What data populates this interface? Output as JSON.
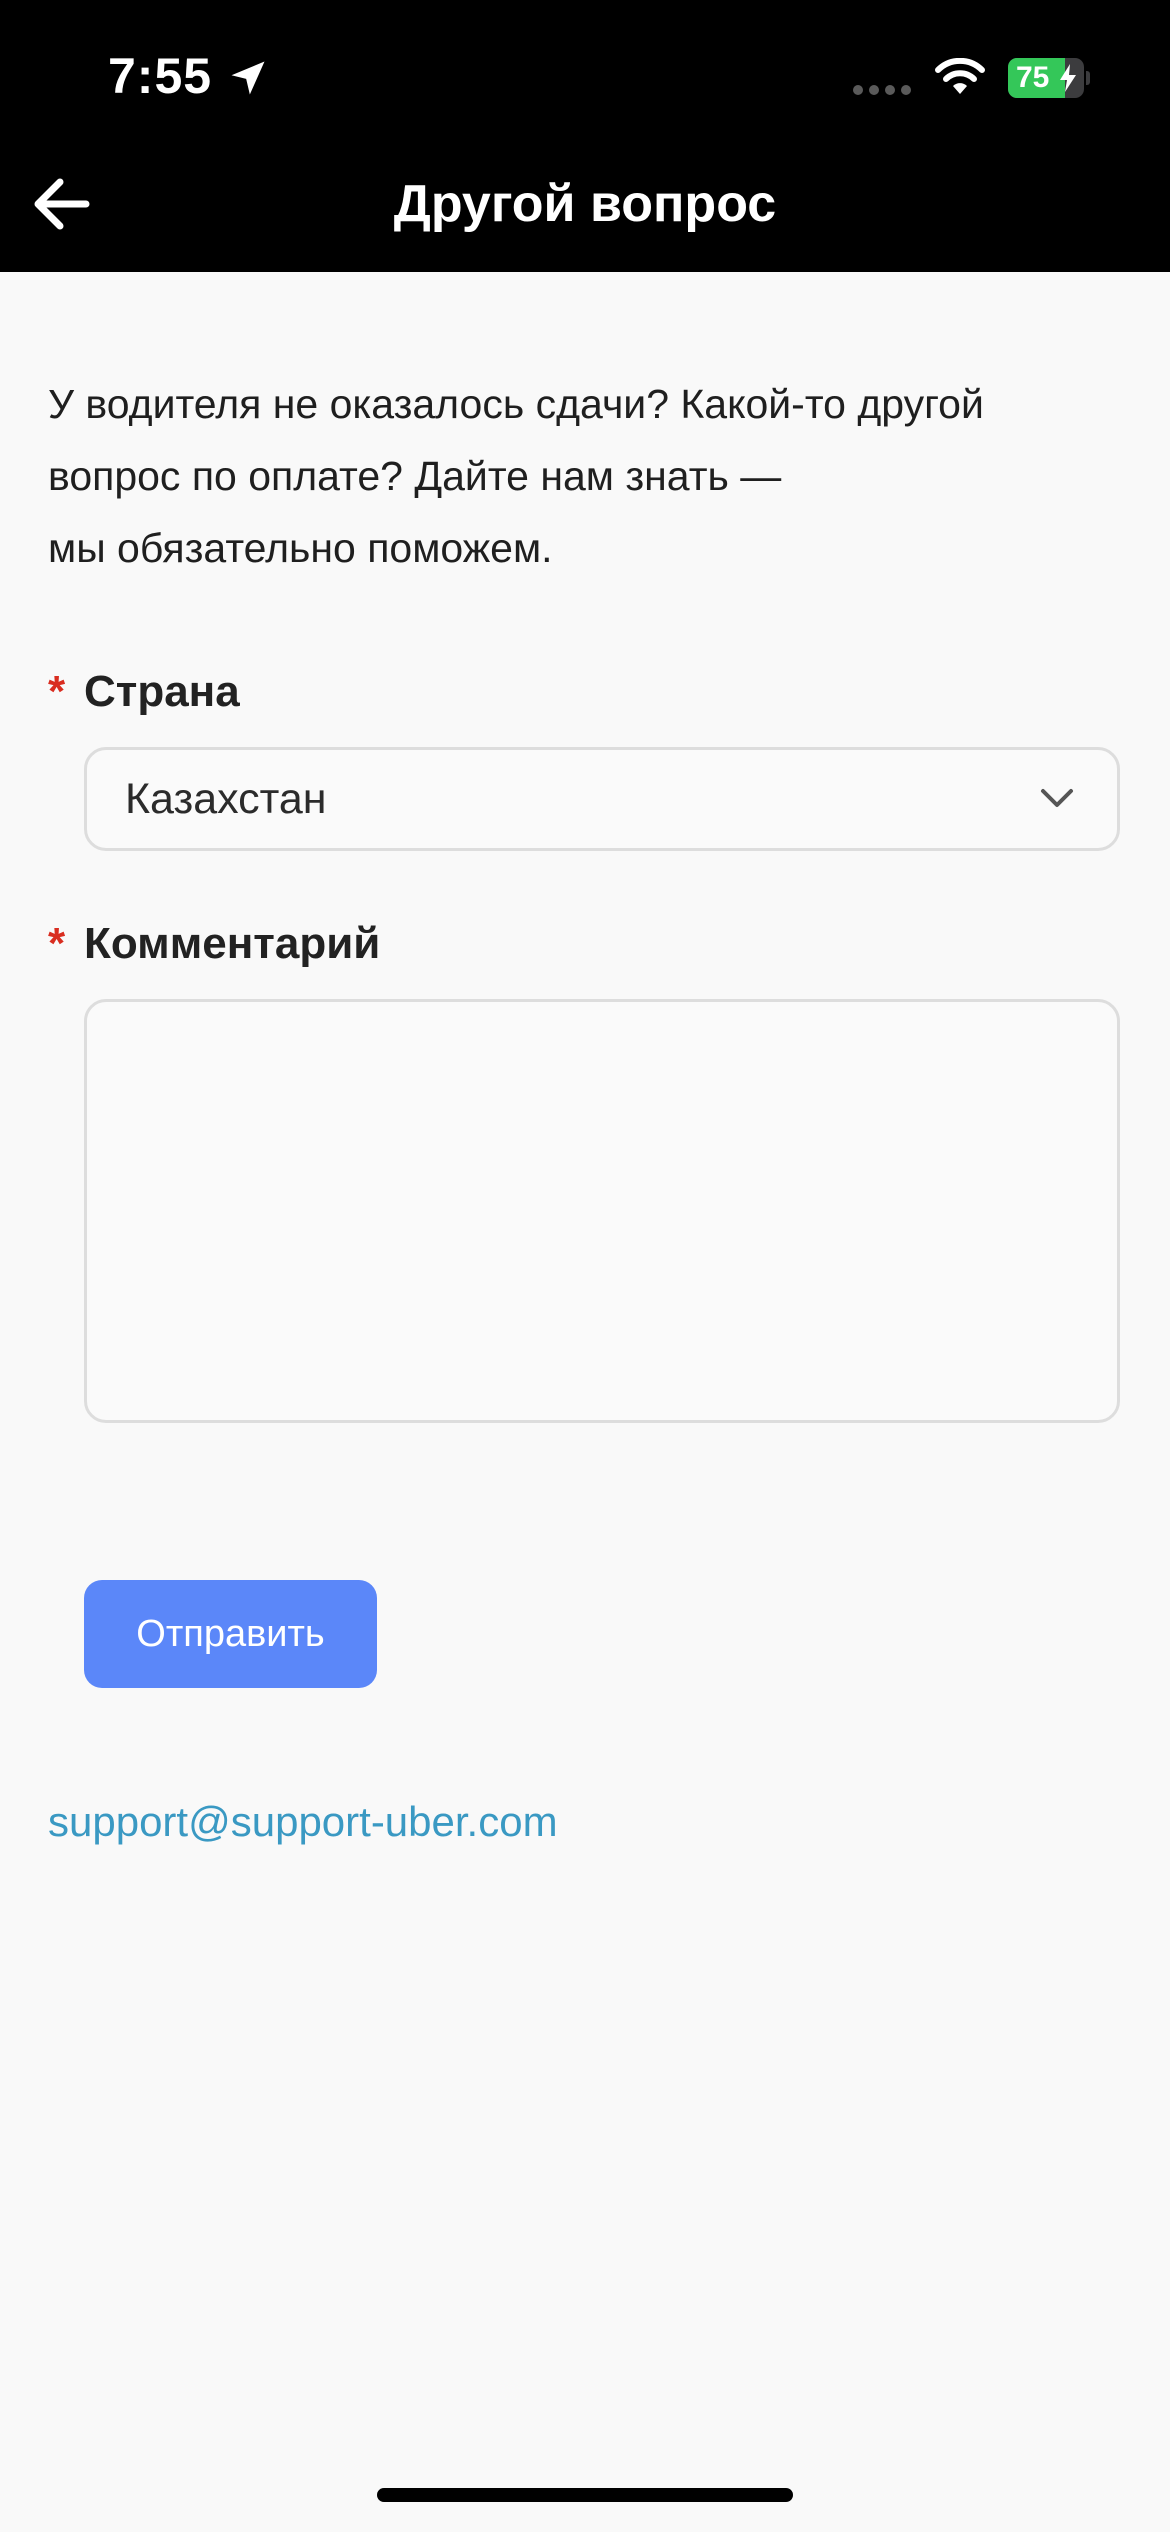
{
  "status_bar": {
    "time": "7:55",
    "battery_level": "75",
    "icons": [
      "location-arrow-icon",
      "cellular-signal-icon",
      "wifi-icon",
      "battery-icon",
      "charging-bolt-icon"
    ]
  },
  "nav": {
    "back_icon": "arrow-left-icon",
    "title": "Другой вопрос"
  },
  "intro": {
    "line1": "У водителя не оказалось сдачи? Какой-то другой",
    "line2": "вопрос по оплате? Дайте нам знать —",
    "line3": "мы обязательно поможем."
  },
  "form": {
    "required_mark": "*",
    "country": {
      "label": "Страна",
      "selected": "Казахстан",
      "icon": "chevron-down-icon"
    },
    "comment": {
      "label": "Комментарий",
      "value": ""
    },
    "submit_label": "Отправить"
  },
  "support_email": "support@support-uber.com",
  "colors": {
    "header_bg": "#000000",
    "page_bg": "#f9f9f9",
    "required": "#d92d20",
    "button": "#5b87f9",
    "link": "#3a99c3",
    "battery": "#34c759"
  }
}
